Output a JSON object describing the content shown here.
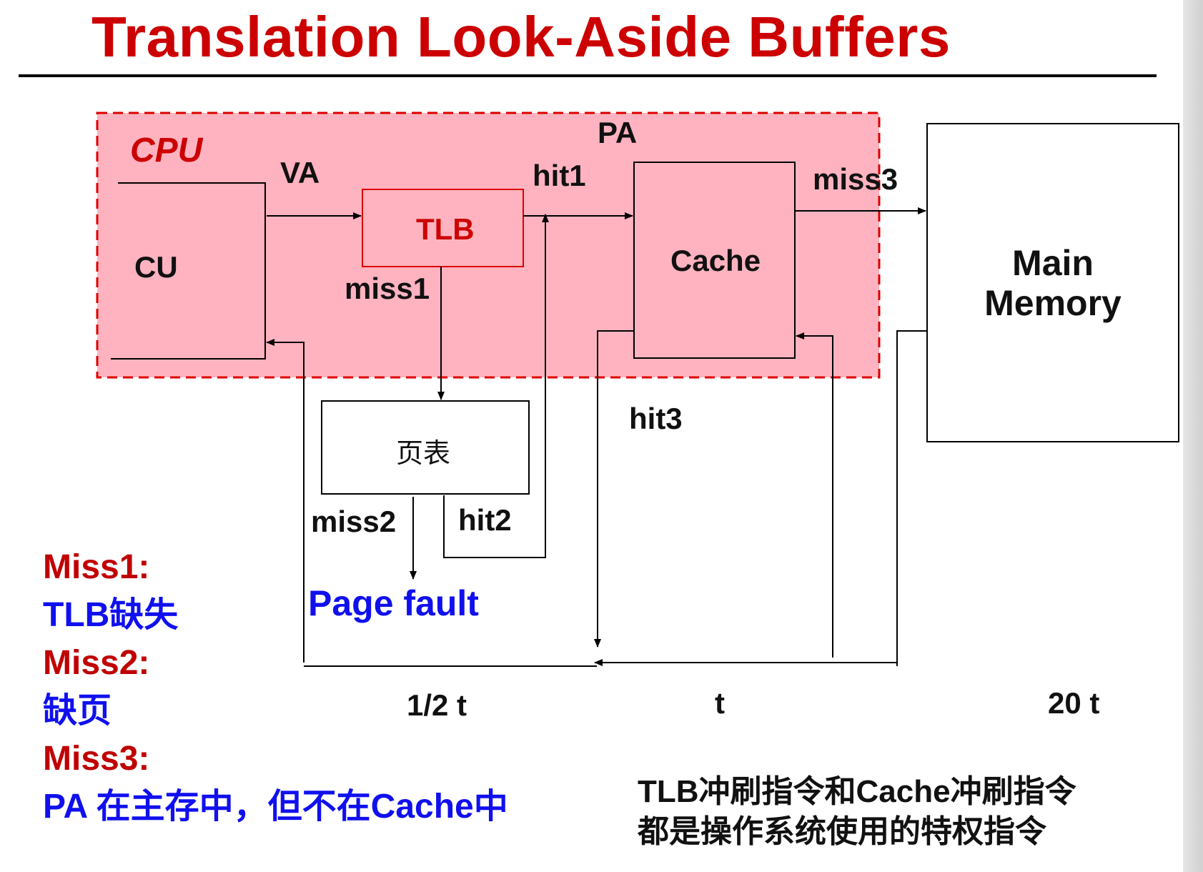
{
  "title": "Translation Look-Aside Buffers",
  "diagram": {
    "cpu_label": "CPU",
    "cu_label": "CU",
    "va_label": "VA",
    "tlb_label": "TLB",
    "pa_label": "PA",
    "hit1_label": "hit1",
    "miss1_label": "miss1",
    "cache_label": "Cache",
    "miss3_label": "miss3",
    "main_memory_line1": "Main",
    "main_memory_line2": "Memory",
    "page_table_label": "页表",
    "hit3_label": "hit3",
    "miss2_label": "miss2",
    "hit2_label": "hit2",
    "page_fault_label": "Page fault",
    "time_half": "1/2 t",
    "time_t": "t",
    "time_20": "20 t"
  },
  "legend": [
    {
      "key": "Miss1:",
      "value": "TLB缺失"
    },
    {
      "key": "Miss2:",
      "value": "缺页"
    },
    {
      "key": "Miss3:",
      "value": "PA 在主存中，但不在Cache中"
    }
  ],
  "note": {
    "line1": "TLB冲刷指令和Cache冲刷指令",
    "line2": "都是操作系统使用的特权指令"
  },
  "colors": {
    "title_red": "#cc0000",
    "cpu_region_fill": "#ffb3c0",
    "cpu_region_border": "#dd0000",
    "blue_text": "#1010ee"
  }
}
